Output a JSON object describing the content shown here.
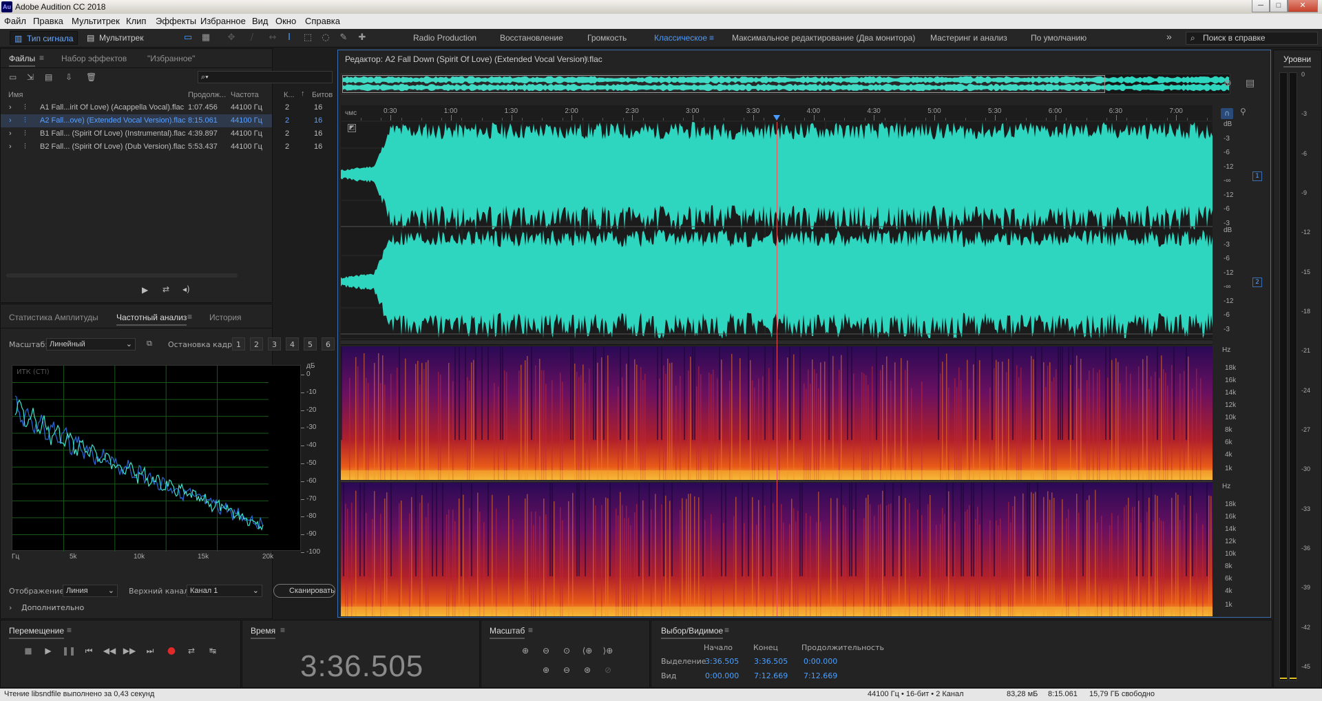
{
  "window": {
    "title": "Adobe Audition CC 2018",
    "minimize": "─",
    "maximize": "□",
    "close": "✕"
  },
  "menu": [
    "Файл",
    "Правка",
    "Мультитрек",
    "Клип",
    "Эффекты",
    "Избранное",
    "Вид",
    "Окно",
    "Справка"
  ],
  "toolbar": {
    "mode_waveform": "Тип сигнала",
    "mode_multitrack": "Мультитрек",
    "workspaces": [
      "Radio Production",
      "Восстановление",
      "Громкость",
      "Классическое",
      "Максимальное редактирование (Два монитора)",
      "Мастеринг и анализ",
      "По умолчанию"
    ],
    "active_workspace": "Классическое",
    "more": "»",
    "help_search_placeholder": "Поиск в справке"
  },
  "files_panel": {
    "tabs": [
      "Файлы",
      "Набор эффектов",
      "\"Избранное\""
    ],
    "columns": {
      "name": "Имя",
      "duration": "Продолж...",
      "rate": "Частота",
      "channels": "К...",
      "bits": "Битов"
    },
    "files": [
      {
        "name": "A1 Fall...irit Of Love) (Acappella Vocal).flac",
        "duration": "1:07.456",
        "rate": "44100 Гц",
        "channels": "2",
        "bits": "16"
      },
      {
        "name": "A2 Fall...ove) (Extended Vocal Version).flac",
        "duration": "8:15.061",
        "rate": "44100 Гц",
        "channels": "2",
        "bits": "16"
      },
      {
        "name": "B1 Fall... (Spirit Of Love) (Instrumental).flac",
        "duration": "4:39.897",
        "rate": "44100 Гц",
        "channels": "2",
        "bits": "16"
      },
      {
        "name": "B2 Fall... (Spirit Of Love) (Dub Version).flac",
        "duration": "5:53.437",
        "rate": "44100 Гц",
        "channels": "2",
        "bits": "16"
      }
    ],
    "selected_index": 1
  },
  "analysis_panel": {
    "tabs": [
      "Статистика Амплитуды",
      "Частотный анализ",
      "История"
    ],
    "scale_label": "Масштаб:",
    "scale_value": "Линейный",
    "freeze_label": "Остановка кадра:",
    "freeze_buttons": [
      "1",
      "2",
      "3",
      "4",
      "5",
      "6"
    ],
    "freeze_colors": [
      "#d63a2a",
      "#e38a1e",
      "#e6d21e",
      "#8ccf2a",
      "#29b34a",
      "#2ab3d8"
    ],
    "graph_title": "ИТК (CTI)",
    "db_unit": "дБ",
    "db_ticks": [
      "0",
      "-10",
      "-20",
      "-30",
      "-40",
      "-50",
      "-60",
      "-70",
      "-80",
      "-90",
      "-100"
    ],
    "freq_ticks": [
      "Гц",
      "5k",
      "10k",
      "15k",
      "20k"
    ],
    "display_label": "Отображение:",
    "display_value": "Линия",
    "top_channel_label": "Верхний канал:",
    "top_channel_value": "Канал 1",
    "scan_button": "Сканировать",
    "advanced": "Дополнительно"
  },
  "editor": {
    "title": "Редактор: A2 Fall Down (Spirit Of Love) (Extended Vocal Version).flac",
    "ruler_unit": "чмс",
    "ruler_ticks": [
      "0:30",
      "1:00",
      "1:30",
      "2:00",
      "2:30",
      "3:00",
      "3:30",
      "4:00",
      "4:30",
      "5:00",
      "5:30",
      "6:00",
      "6:30",
      "7:00"
    ],
    "db_ticks_ch": [
      "dB",
      "-3",
      "-6",
      "-12",
      "-∞",
      "-12",
      "-6",
      "-3"
    ],
    "channel_badges": [
      "1",
      "2"
    ],
    "hz_ticks": [
      "Hz",
      "18k",
      "16k",
      "14k",
      "12k",
      "10k",
      "8k",
      "6k",
      "4k",
      "1k"
    ],
    "waveform_color": "#2fd6bf",
    "playhead_color": "#e8545a"
  },
  "levels_panel": {
    "title": "Уровни",
    "ticks": [
      "0",
      "-3",
      "-6",
      "-9",
      "-12",
      "-15",
      "-18",
      "-21",
      "-24",
      "-27",
      "-30",
      "-33",
      "-36",
      "-39",
      "-42",
      "-45"
    ]
  },
  "transport": {
    "title": "Перемещение",
    "buttons": [
      "stop",
      "play",
      "pause",
      "go-to-start",
      "rewind",
      "fast-forward",
      "go-to-end",
      "record",
      "loop",
      "skip-selection"
    ]
  },
  "time_panel": {
    "title": "Время",
    "value": "3:36.505"
  },
  "zoom_panel": {
    "title": "Масштаб"
  },
  "selection_panel": {
    "title": "Выбор/Видимое",
    "col_start": "Начало",
    "col_end": "Конец",
    "col_duration": "Продолжительность",
    "rows": [
      {
        "label": "Выделение",
        "start": "3:36.505",
        "end": "3:36.505",
        "duration": "0:00.000"
      },
      {
        "label": "Вид",
        "start": "0:00.000",
        "end": "7:12.669",
        "duration": "7:12.669"
      }
    ]
  },
  "status": {
    "message": "Чтение libsndfile выполнено за 0,43 секунд",
    "format": "44100 Гц • 16-бит • 2 Канал",
    "size": "83,28 мБ",
    "duration": "8:15.061",
    "free": "15,79 ГБ свободно"
  }
}
